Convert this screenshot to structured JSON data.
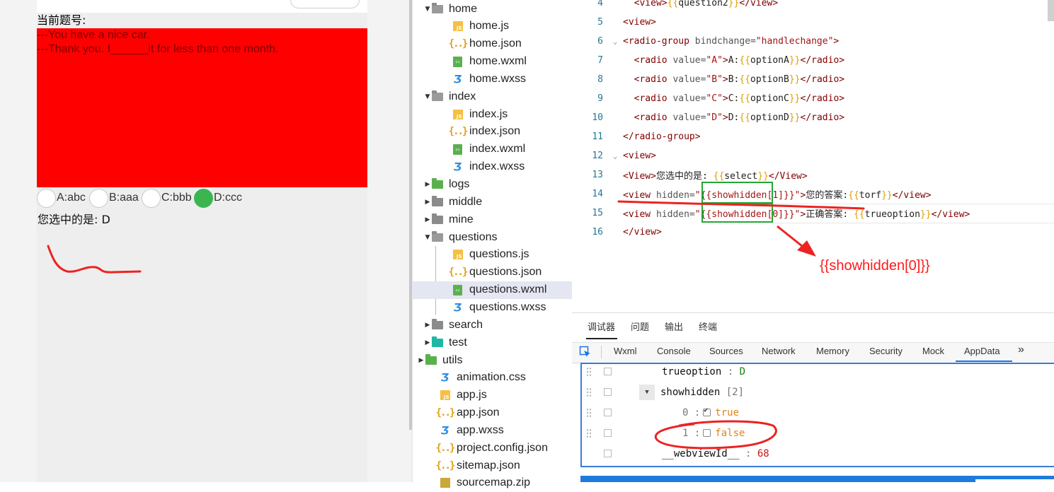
{
  "simulator": {
    "question_label": "当前题号:",
    "question_lines": [
      "---You have a nice car.",
      "---Thank you. I______it for less than one month."
    ],
    "options": [
      {
        "label": "A:abc",
        "checked": false
      },
      {
        "label": "B:aaa",
        "checked": false
      },
      {
        "label": "C:bbb",
        "checked": false
      },
      {
        "label": "D:ccc",
        "checked": true
      }
    ],
    "selected_text": "您选中的是:  D",
    "accent_color": "#3cb551",
    "question_bg": "#ff0000"
  },
  "file_tree": {
    "items": [
      {
        "name": "home",
        "type": "folder-open",
        "expanded": true
      },
      {
        "name": "home.js",
        "type": "js"
      },
      {
        "name": "home.json",
        "type": "json"
      },
      {
        "name": "home.wxml",
        "type": "wxml"
      },
      {
        "name": "home.wxss",
        "type": "wxss"
      },
      {
        "name": "index",
        "type": "folder-open",
        "expanded": true
      },
      {
        "name": "index.js",
        "type": "js"
      },
      {
        "name": "index.json",
        "type": "json"
      },
      {
        "name": "index.wxml",
        "type": "wxml"
      },
      {
        "name": "index.wxss",
        "type": "wxss"
      },
      {
        "name": "logs",
        "type": "folder-green",
        "expanded": false
      },
      {
        "name": "middle",
        "type": "folder",
        "expanded": false
      },
      {
        "name": "mine",
        "type": "folder",
        "expanded": false
      },
      {
        "name": "questions",
        "type": "folder-open",
        "expanded": true
      },
      {
        "name": "questions.js",
        "type": "js"
      },
      {
        "name": "questions.json",
        "type": "json"
      },
      {
        "name": "questions.wxml",
        "type": "wxml",
        "selected": true
      },
      {
        "name": "questions.wxss",
        "type": "wxss"
      },
      {
        "name": "search",
        "type": "folder",
        "expanded": false
      },
      {
        "name": "test",
        "type": "folder-teal",
        "expanded": false
      },
      {
        "name": "utils",
        "type": "folder-green",
        "expanded": false
      },
      {
        "name": "animation.css",
        "type": "wxss"
      },
      {
        "name": "app.js",
        "type": "js"
      },
      {
        "name": "app.json",
        "type": "json"
      },
      {
        "name": "app.wxss",
        "type": "wxss"
      },
      {
        "name": "project.config.json",
        "type": "json"
      },
      {
        "name": "sitemap.json",
        "type": "json"
      },
      {
        "name": "sourcemap.zip",
        "type": "zip"
      }
    ]
  },
  "editor": {
    "lines": [
      {
        "num": "4",
        "code": "  <view>{{question2}}</view>"
      },
      {
        "num": "5",
        "code": "<view>"
      },
      {
        "num": "6",
        "code": "<radio-group bindchange=\"handlechange\">"
      },
      {
        "num": "7",
        "code": "  <radio value=\"A\">A:{{optionA}}</radio>"
      },
      {
        "num": "8",
        "code": "  <radio value=\"B\">B:{{optionB}}</radio>"
      },
      {
        "num": "9",
        "code": "  <radio value=\"C\">C:{{optionC}}</radio>"
      },
      {
        "num": "10",
        "code": "  <radio value=\"D\">D:{{optionD}}</radio>"
      },
      {
        "num": "11",
        "code": "</radio-group>"
      },
      {
        "num": "12",
        "code": "<view>"
      },
      {
        "num": "13",
        "code": "<View>您选中的是: {{select}}</View>"
      },
      {
        "num": "14",
        "code": "<view hidden=\"{{showhidden[1]}}\">您的答案:{{torf}}</view>"
      },
      {
        "num": "15",
        "code": "<view hidden=\"{{showhidden[0]}}\">正确答案: {{trueoption}}</view>"
      },
      {
        "num": "16",
        "code": "</view>"
      }
    ],
    "annotation": "{{showhidden[0]}}"
  },
  "devtools": {
    "tabs": [
      "调试器",
      "问题",
      "输出",
      "终端"
    ],
    "subtabs": [
      "Wxml",
      "Console",
      "Sources",
      "Network",
      "Memory",
      "Security",
      "Mock",
      "AppData"
    ],
    "active_subtab": "AppData",
    "more_label": "»",
    "rows": {
      "trueoption_key": "trueoption",
      "trueoption_val": "D",
      "showhidden_key": "showhidden",
      "showhidden_len": "[2]",
      "item0_key": "0",
      "item0_val": "true",
      "item1_key": "1",
      "item1_val": "false",
      "webview_key": "__webviewId__",
      "webview_val": "68"
    }
  }
}
